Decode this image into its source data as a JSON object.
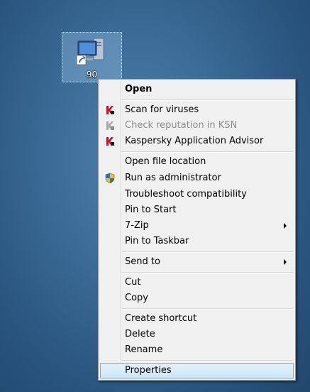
{
  "desktop_icon": {
    "label": "90",
    "icon": "computer-shortcut-icon"
  },
  "menu": {
    "items": [
      {
        "label": "Open",
        "bold": true,
        "icon": null
      },
      {
        "label": "Scan for viruses",
        "icon": "kaspersky-icon"
      },
      {
        "label": "Check reputation in KSN",
        "disabled": true,
        "icon": "kaspersky-icon"
      },
      {
        "label": "Kaspersky Application Advisor",
        "icon": "kaspersky-icon"
      },
      {
        "label": "Open file location",
        "icon": null
      },
      {
        "label": "Run as administrator",
        "icon": "uac-shield-icon"
      },
      {
        "label": "Troubleshoot compatibility",
        "icon": null
      },
      {
        "label": "Pin to Start",
        "icon": null
      },
      {
        "label": "7-Zip",
        "submenu": true,
        "icon": null
      },
      {
        "label": "Pin to Taskbar",
        "icon": null
      },
      {
        "label": "Send to",
        "submenu": true,
        "icon": null
      },
      {
        "label": "Cut",
        "icon": null
      },
      {
        "label": "Copy",
        "icon": null
      },
      {
        "label": "Create shortcut",
        "icon": null
      },
      {
        "label": "Delete",
        "icon": null
      },
      {
        "label": "Rename",
        "icon": null
      },
      {
        "label": "Properties",
        "highlighted": true,
        "icon": null
      }
    ]
  },
  "colors": {
    "kaspersky_red": "#c8102e",
    "highlight_border": "#84acdd"
  }
}
